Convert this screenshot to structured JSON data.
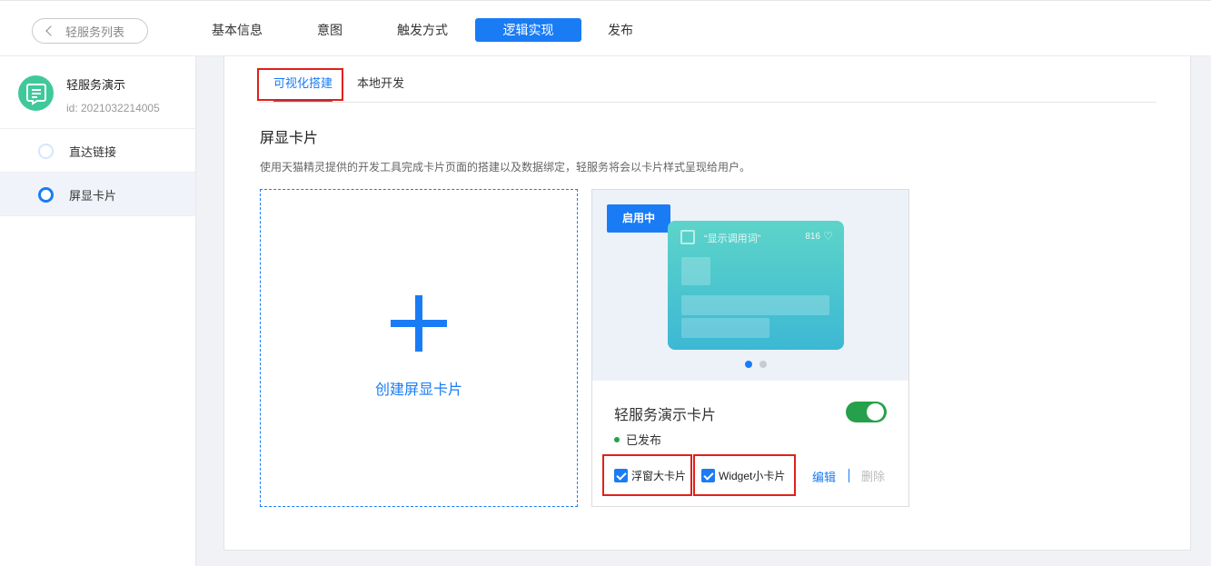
{
  "header": {
    "back_label": "轻服务列表",
    "tabs": [
      "基本信息",
      "意图",
      "触发方式",
      "逻辑实现",
      "发布"
    ],
    "active_tab": "逻辑实现"
  },
  "sidebar": {
    "service_name": "轻服务演示",
    "service_id": "id: 2021032214005",
    "items": [
      {
        "label": "直达链接",
        "active": false
      },
      {
        "label": "屏显卡片",
        "active": true
      }
    ]
  },
  "main": {
    "subtabs": [
      "可视化搭建",
      "本地开发"
    ],
    "active_subtab": "可视化搭建",
    "section_title": "屏显卡片",
    "section_desc": "使用天猫精灵提供的开发工具完成卡片页面的搭建以及数据绑定，轻服务将会以卡片样式呈现给用户。",
    "create_label": "创建屏显卡片",
    "card": {
      "status_tag": "启用中",
      "preview_title": "“显示调用词”",
      "preview_count": "816",
      "name": "轻服务演示卡片",
      "enabled": true,
      "status": "已发布",
      "checkbox_float": "浮窗大卡片",
      "checkbox_widget": "Widget小卡片",
      "edit_label": "编辑",
      "delete_label": "删除"
    }
  },
  "colors": {
    "primary": "#1a7cf5",
    "toggle_on": "#26a04a",
    "highlight_box": "#e0201a",
    "avatar": "#3fc99a"
  }
}
